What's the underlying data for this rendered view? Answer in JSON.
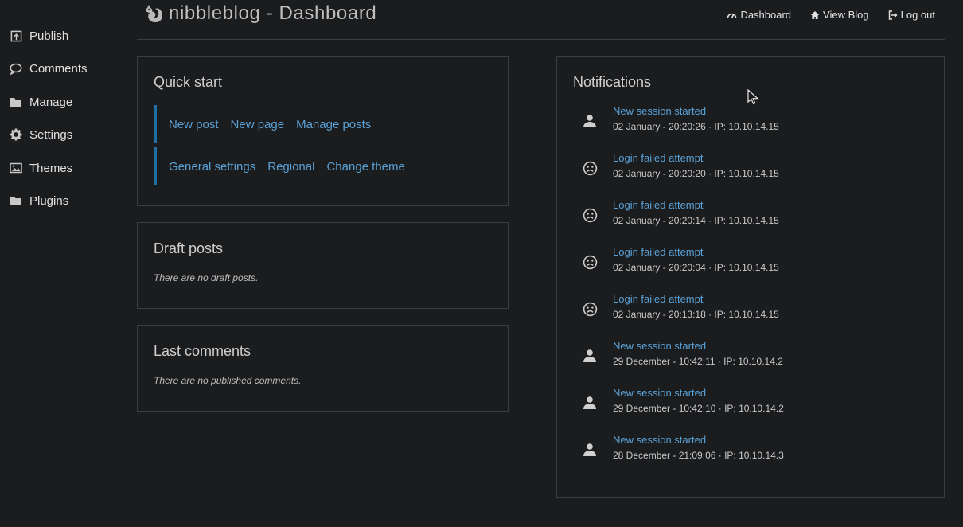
{
  "app": {
    "title": "nibbleblog - Dashboard"
  },
  "sidebar": {
    "items": [
      {
        "label": "Publish",
        "icon": "publish-icon"
      },
      {
        "label": "Comments",
        "icon": "comment-icon"
      },
      {
        "label": "Manage",
        "icon": "folder-icon"
      },
      {
        "label": "Settings",
        "icon": "gear-icon"
      },
      {
        "label": "Themes",
        "icon": "image-icon"
      },
      {
        "label": "Plugins",
        "icon": "folder-icon"
      }
    ]
  },
  "header": {
    "nav": [
      {
        "label": "Dashboard",
        "icon": "dashboard-icon"
      },
      {
        "label": "View Blog",
        "icon": "home-icon"
      },
      {
        "label": "Log out",
        "icon": "logout-icon"
      }
    ]
  },
  "quick_start": {
    "title": "Quick start",
    "row1": [
      "New post",
      "New page",
      "Manage posts"
    ],
    "row2": [
      "General settings",
      "Regional",
      "Change theme"
    ],
    "accent": "#1e6fa8"
  },
  "draft_posts": {
    "title": "Draft posts",
    "empty": "There are no draft posts."
  },
  "last_comments": {
    "title": "Last comments",
    "empty": "There are no published comments."
  },
  "notifications": {
    "title": "Notifications",
    "items": [
      {
        "title": "New session started",
        "meta": "02 January - 20:20:26 · IP: 10.10.14.15",
        "icon": "user-icon"
      },
      {
        "title": "Login failed attempt",
        "meta": "02 January - 20:20:20 · IP: 10.10.14.15",
        "icon": "frown-icon"
      },
      {
        "title": "Login failed attempt",
        "meta": "02 January - 20:20:14 · IP: 10.10.14.15",
        "icon": "frown-icon"
      },
      {
        "title": "Login failed attempt",
        "meta": "02 January - 20:20:04 · IP: 10.10.14.15",
        "icon": "frown-icon"
      },
      {
        "title": "Login failed attempt",
        "meta": "02 January - 20:13:18 · IP: 10.10.14.15",
        "icon": "frown-icon"
      },
      {
        "title": "New session started",
        "meta": "29 December - 10:42:11 · IP: 10.10.14.2",
        "icon": "user-icon"
      },
      {
        "title": "New session started",
        "meta": "29 December - 10:42:10 · IP: 10.10.14.2",
        "icon": "user-icon"
      },
      {
        "title": "New session started",
        "meta": "28 December - 21:09:06 · IP: 10.10.14.3",
        "icon": "user-icon"
      }
    ]
  },
  "colors": {
    "link": "#5aa1d6",
    "background": "#1b1c1e",
    "border": "#3c3d40"
  }
}
